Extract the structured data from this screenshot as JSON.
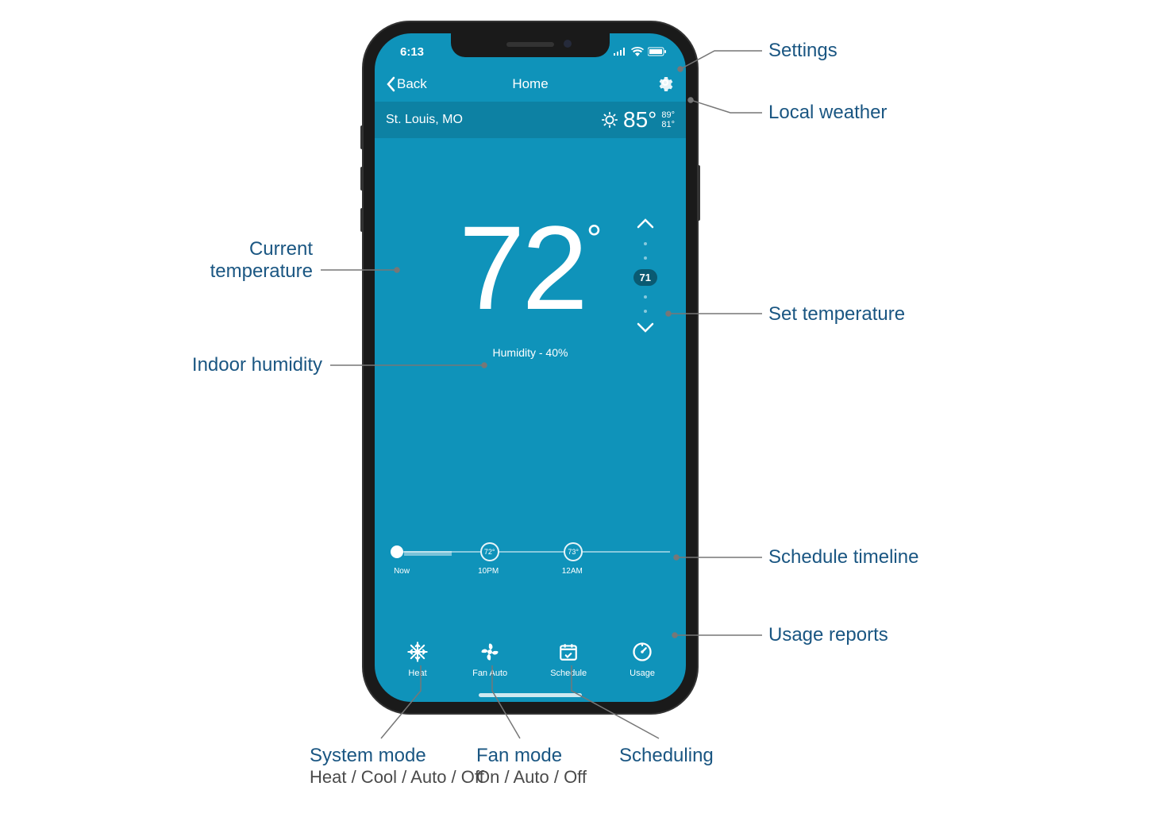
{
  "statusbar": {
    "time": "6:13"
  },
  "nav": {
    "back": "Back",
    "title": "Home"
  },
  "weather": {
    "location": "St. Louis, MO",
    "current": "85°",
    "high": "89°",
    "low": "81°"
  },
  "temperature": {
    "current": "72",
    "humidity_label": "Humidity - 40%",
    "set": "71"
  },
  "timeline": {
    "now_label": "Now",
    "points": [
      {
        "temp": "72°",
        "label": "10PM",
        "pos": 32
      },
      {
        "temp": "73°",
        "label": "12AM",
        "pos": 62
      }
    ]
  },
  "bottom_nav": {
    "heat": "Heat",
    "fan": "Fan Auto",
    "schedule": "Schedule",
    "usage": "Usage"
  },
  "annotations": {
    "settings": "Settings",
    "local_weather": "Local weather",
    "current_temp_l1": "Current",
    "current_temp_l2": "temperature",
    "set_temp": "Set temperature",
    "humidity": "Indoor humidity",
    "schedule_timeline": "Schedule timeline",
    "usage_reports": "Usage reports",
    "system_mode": "System mode",
    "system_mode_sub": "Heat / Cool / Auto / Off",
    "fan_mode": "Fan mode",
    "fan_mode_sub": "On / Auto / Off",
    "scheduling": "Scheduling"
  }
}
